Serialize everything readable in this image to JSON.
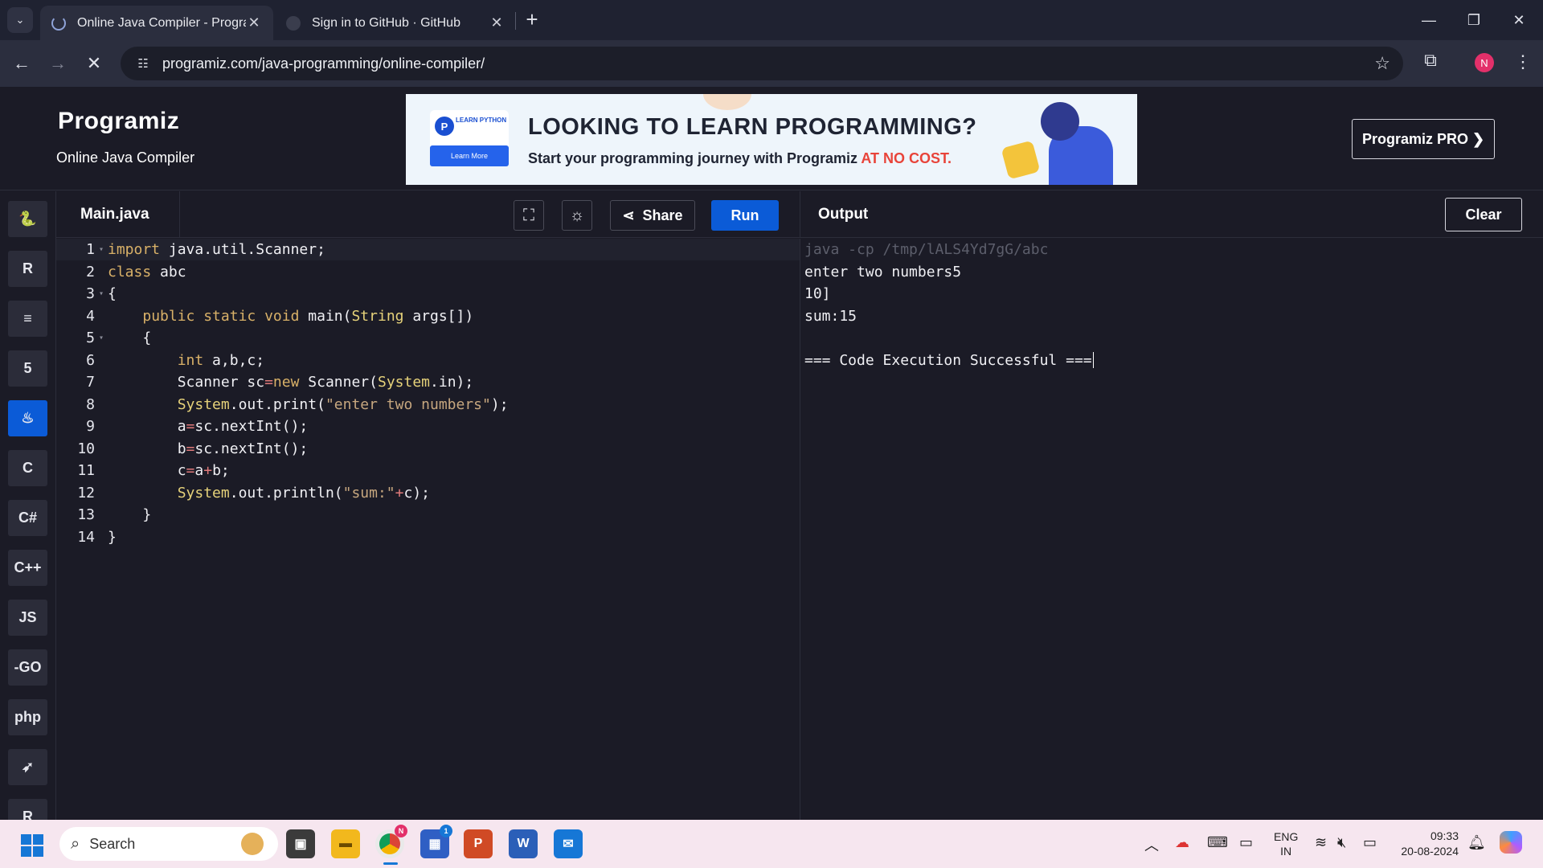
{
  "browser": {
    "tabs": [
      {
        "title": "Online Java Compiler - Program",
        "active": true
      },
      {
        "title": "Sign in to GitHub · GitHub",
        "active": false
      }
    ],
    "url": "programiz.com/java-programming/online-compiler/",
    "profile_initial": "N"
  },
  "header": {
    "logo": "Programiz",
    "subtitle": "Online Java Compiler",
    "pro_button": "Programiz PRO ❯"
  },
  "banner": {
    "badge_text": "LEARN PYTHON",
    "learn_more": "Learn More",
    "headline": "LOOKING TO LEARN PROGRAMMING?",
    "subline_prefix": "Start your programming journey with Programiz ",
    "subline_highlight": "AT NO COST.",
    "highlight_color": "#e8443a"
  },
  "sidebar": {
    "languages": [
      {
        "name": "python",
        "label": "🐍"
      },
      {
        "name": "r",
        "label": "R"
      },
      {
        "name": "sql",
        "label": "≡"
      },
      {
        "name": "html",
        "label": "5"
      },
      {
        "name": "java",
        "label": "♨",
        "active": true
      },
      {
        "name": "c",
        "label": "C"
      },
      {
        "name": "csharp",
        "label": "C#"
      },
      {
        "name": "cpp",
        "label": "C++"
      },
      {
        "name": "javascript",
        "label": "JS"
      },
      {
        "name": "go",
        "label": "-GO"
      },
      {
        "name": "php",
        "label": "php"
      },
      {
        "name": "swift",
        "label": "➶"
      },
      {
        "name": "rust",
        "label": "R"
      }
    ]
  },
  "editor": {
    "file_name": "Main.java",
    "share_label": "Share",
    "run_label": "Run",
    "accent": "#0b5bd7",
    "lines": [
      {
        "n": "1",
        "fold": true,
        "tokens": [
          [
            "kw",
            "import"
          ],
          [
            "code",
            " java.util.Scanner;"
          ]
        ]
      },
      {
        "n": "2",
        "fold": false,
        "tokens": [
          [
            "kw",
            "class"
          ],
          [
            "code",
            " abc"
          ]
        ]
      },
      {
        "n": "3",
        "fold": true,
        "tokens": [
          [
            "code",
            "{"
          ]
        ]
      },
      {
        "n": "4",
        "fold": false,
        "tokens": [
          [
            "code",
            "    "
          ],
          [
            "kw",
            "public static void"
          ],
          [
            "code",
            " main("
          ],
          [
            "tp",
            "String"
          ],
          [
            "code",
            " args[])"
          ]
        ]
      },
      {
        "n": "5",
        "fold": true,
        "tokens": [
          [
            "code",
            "    {"
          ]
        ]
      },
      {
        "n": "6",
        "fold": false,
        "tokens": [
          [
            "code",
            "        "
          ],
          [
            "kw",
            "int"
          ],
          [
            "code",
            " a,b,c;"
          ]
        ]
      },
      {
        "n": "7",
        "fold": false,
        "tokens": [
          [
            "code",
            "        Scanner sc"
          ],
          [
            "op",
            "="
          ],
          [
            "kw",
            "new"
          ],
          [
            "code",
            " Scanner("
          ],
          [
            "tp",
            "System"
          ],
          [
            "code",
            ".in);"
          ]
        ]
      },
      {
        "n": "8",
        "fold": false,
        "tokens": [
          [
            "code",
            "        "
          ],
          [
            "tp",
            "System"
          ],
          [
            "code",
            ".out.print("
          ],
          [
            "st",
            "\"enter two numbers\""
          ],
          [
            "code",
            ");"
          ]
        ]
      },
      {
        "n": "9",
        "fold": false,
        "tokens": [
          [
            "code",
            "        a"
          ],
          [
            "op",
            "="
          ],
          [
            "code",
            "sc.nextInt();"
          ]
        ]
      },
      {
        "n": "10",
        "fold": false,
        "tokens": [
          [
            "code",
            "        b"
          ],
          [
            "op",
            "="
          ],
          [
            "code",
            "sc.nextInt();"
          ]
        ]
      },
      {
        "n": "11",
        "fold": false,
        "tokens": [
          [
            "code",
            "        c"
          ],
          [
            "op",
            "="
          ],
          [
            "code",
            "a"
          ],
          [
            "op",
            "+"
          ],
          [
            "code",
            "b;"
          ]
        ]
      },
      {
        "n": "12",
        "fold": false,
        "tokens": [
          [
            "code",
            "        "
          ],
          [
            "tp",
            "System"
          ],
          [
            "code",
            ".out.println("
          ],
          [
            "st",
            "\"sum:\""
          ],
          [
            "op",
            "+"
          ],
          [
            "code",
            "c);"
          ]
        ]
      },
      {
        "n": "13",
        "fold": false,
        "tokens": [
          [
            "code",
            "    }"
          ]
        ]
      },
      {
        "n": "14",
        "fold": false,
        "tokens": [
          [
            "code",
            "}"
          ]
        ]
      }
    ]
  },
  "output": {
    "title": "Output",
    "clear_label": "Clear",
    "lines": [
      {
        "text": "java -cp /tmp/lALS4Yd7gG/abc",
        "dim": true
      },
      {
        "text": "enter two numbers5",
        "dim": false
      },
      {
        "text": "10]",
        "dim": false
      },
      {
        "text": "sum:15",
        "dim": false
      },
      {
        "text": "",
        "dim": false
      },
      {
        "text": "=== Code Execution Successful ===",
        "dim": false,
        "caret": true
      }
    ]
  },
  "taskbar": {
    "search_placeholder": "Search",
    "store_badge": "1",
    "chrome_badge": "N",
    "language_top": "ENG",
    "language_bottom": "IN",
    "time": "09:33",
    "date": "20-08-2024"
  }
}
